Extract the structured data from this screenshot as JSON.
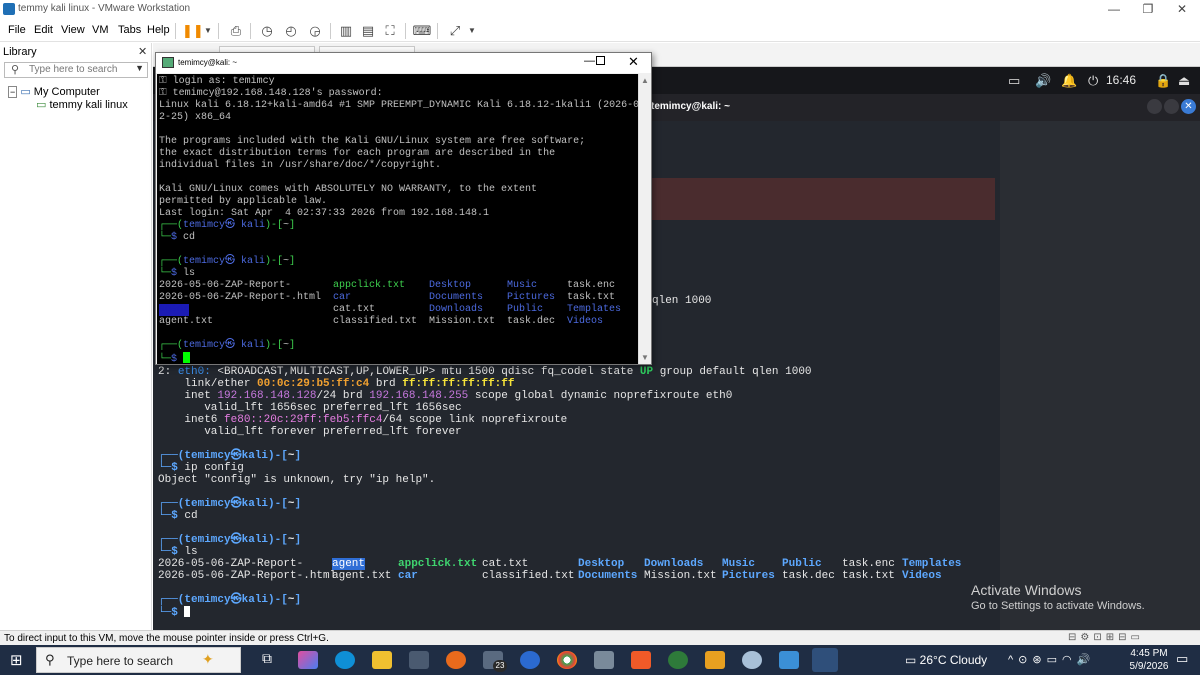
{
  "app": {
    "title": "temmy kali linux - VMware Workstation",
    "window_controls": [
      "—",
      "❐",
      "✕"
    ]
  },
  "menu": [
    "File",
    "Edit",
    "View",
    "VM",
    "Tabs",
    "Help"
  ],
  "library": {
    "header": "Library",
    "close": "✕",
    "search_placeholder": "Type here to search",
    "root": "My Computer",
    "vm": "temmy kali linux"
  },
  "kali": {
    "clock": "16:46",
    "terminal_title": "temimcy@kali: ~",
    "bg_fragment": "qlen 1000"
  },
  "bg_terminal": {
    "eth_num": "2: ",
    "eth_name": "eth0:",
    "eth_flags_a": " <BROADCAST,MULTICAST,UP,LOWER_UP> mtu 1500 qdisc fq_codel state ",
    "eth_state": "UP",
    "eth_flags_b": " group default qlen 1000",
    "link_a": "    link/ether ",
    "link_mac": "00:0c:29:b5:ff:c4",
    "link_b": " brd ",
    "link_brd": "ff:ff:ff:ff:ff:ff",
    "inet_a": "    inet ",
    "inet_ip": "192.168.148.128",
    "inet_b": "/24 brd ",
    "inet_brd": "192.168.148.255",
    "inet_c": " scope global dynamic noprefixroute eth0",
    "valid1": "       valid_lft 1656sec preferred_lft 1656sec",
    "inet6_a": "    inet6 ",
    "inet6_ip": "fe80::20c:29ff:feb5:ffc4",
    "inet6_b": "/64 scope link noprefixroute",
    "valid2": "       valid_lft forever preferred_lft forever",
    "prompt_top": "┌──(",
    "prompt_user": "temimcy㉿kali",
    "prompt_mid": ")-[",
    "prompt_dir": "~",
    "prompt_end": "]",
    "prompt_bot": "└─",
    "prompt_dollar": "$ ",
    "cmd_ip": "ip config",
    "err_ip": "Object \"config\" is unknown, try \"ip help\".",
    "cmd_cd": "cd",
    "cmd_ls": "ls",
    "files_row1": [
      "2026-05-06-ZAP-Report-",
      "agent",
      "appclick.txt",
      "cat.txt",
      "Desktop",
      "Downloads",
      "Music",
      "Public",
      "task.enc",
      "Templates"
    ],
    "files_row2": [
      "2026-05-06-ZAP-Report-.html",
      "agent.txt",
      "car",
      "classified.txt",
      "Documents",
      "Mission.txt",
      "Pictures",
      "task.dec",
      "task.txt",
      "Videos"
    ]
  },
  "putty": {
    "title": "temimcy@kali: ~",
    "login": " login as: temimcy",
    "password": " temimcy@192.168.148.128's password:",
    "linux1": "Linux kali 6.18.12+kali-amd64 #1 SMP PREEMPT_DYNAMIC Kali 6.18.12-1kali1 (2026-0",
    "linux2": "2-25) x86_64",
    "progs1": "The programs included with the Kali GNU/Linux system are free software;",
    "progs2": "the exact distribution terms for each program are described in the",
    "progs3": "individual files in /usr/share/doc/*/copyright.",
    "warr1": "Kali GNU/Linux comes with ABSOLUTELY NO WARRANTY, to the extent",
    "warr2": "permitted by applicable law.",
    "lastlogin": "Last login: Sat Apr  4 02:37:33 2026 from 192.168.148.1",
    "prompt_top": "┌──(",
    "prompt_user": "temimcy㉿ kali",
    "prompt_mid": ")-[",
    "prompt_dir": "~",
    "prompt_end": "]",
    "prompt_bot": "└─",
    "prompt_dollar": "$ ",
    "cmd_cd": "cd",
    "cmd_ls": "ls",
    "grid": [
      [
        "2026-05-06-ZAP-Report-",
        "appclick.txt",
        "Desktop",
        "Music",
        "task.enc"
      ],
      [
        "2026-05-06-ZAP-Report-.html",
        "car",
        "Documents",
        "Pictures",
        "task.txt"
      ],
      [
        "agent",
        "cat.txt",
        "Downloads",
        "Public",
        "Templates"
      ],
      [
        "agent.txt",
        "classified.txt",
        "Mission.txt",
        "task.dec",
        "Videos"
      ]
    ]
  },
  "watermark": {
    "line1": "Activate Windows",
    "line2": "Go to Settings to activate Windows."
  },
  "statusbar": "To direct input to this VM, move the mouse pointer inside or press Ctrl+G.",
  "taskbar": {
    "search_placeholder": "Type here to search",
    "badge": "23",
    "weather": "26°C  Cloudy",
    "time": "4:45 PM",
    "date": "5/9/2026"
  }
}
